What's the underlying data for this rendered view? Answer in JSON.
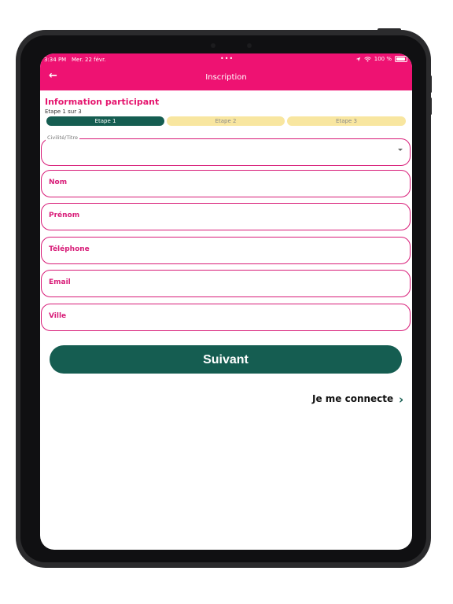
{
  "status_bar": {
    "time": "3:34 PM",
    "date": "Mer. 22 févr.",
    "dots": "•••",
    "battery_pct": "100 %"
  },
  "header": {
    "back_icon": "←",
    "title": "Inscription"
  },
  "form": {
    "section_title": "Information participant",
    "step_label": "Etape 1 sur 3",
    "steps": [
      {
        "label": "Etape 1"
      },
      {
        "label": "Etape 2"
      },
      {
        "label": "Etape 3"
      }
    ],
    "fields": {
      "civility_legend": "Civilité/Titre",
      "civility_value": "",
      "nom": "Nom",
      "prenom": "Prénom",
      "telephone": "Téléphone",
      "email": "Email",
      "ville": "Ville"
    },
    "submit_label": "Suivant",
    "login_label": "Je me connecte",
    "login_icon": "›"
  },
  "icons": {
    "wifi": "wifi-icon",
    "location": "location-arrow-icon",
    "battery": "battery-icon"
  },
  "colors": {
    "header_bg": "#ee1272",
    "accent_pink": "#d81c78",
    "primary_green": "#155d51",
    "step_inactive": "#f8e6a0"
  }
}
